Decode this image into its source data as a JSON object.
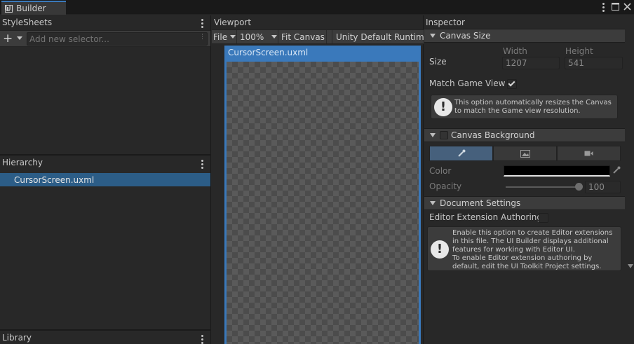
{
  "window": {
    "tab_title": "UI Builder"
  },
  "stylesheets": {
    "title": "StyleSheets",
    "add_symbol": "+",
    "selector_placeholder": "Add new selector...",
    "input_dots": "⋮"
  },
  "hierarchy": {
    "title": "Hierarchy",
    "items": [
      {
        "label": "CursorScreen.uxml",
        "selected": true
      }
    ]
  },
  "library": {
    "title": "Library"
  },
  "viewport": {
    "title": "Viewport",
    "toolbar": {
      "file": "File",
      "zoom": "100%",
      "fit_canvas": "Fit Canvas",
      "theme": "Unity Default Runtime"
    },
    "canvas_title": "CursorScreen.uxml"
  },
  "inspector": {
    "title": "Inspector",
    "canvas_size": {
      "header": "Canvas Size",
      "size_label": "Size",
      "width_label": "Width",
      "height_label": "Height",
      "width_value": "1207",
      "height_value": "541",
      "match_game_view_label": "Match Game View",
      "match_game_view_checked": true,
      "help_text": "This option automatically resizes the Canvas to match the Game view resolution."
    },
    "canvas_background": {
      "header": "Canvas Background",
      "enabled": false,
      "color_label": "Color",
      "color_value": "#000000",
      "opacity_label": "Opacity",
      "opacity_value": "100",
      "opacity_level": 1.0
    },
    "document_settings": {
      "header": "Document Settings",
      "editor_extension_label": "Editor Extension Authoring",
      "editor_extension_checked": false,
      "help_text_1": "Enable this option to create Editor extensions in this file. The UI Builder displays additional features for working with Editor UI.",
      "help_text_2": "To enable Editor extension authoring by default, edit the UI Toolkit Project settings."
    },
    "warning_symbol": "!"
  },
  "colors": {
    "accent": "#3a79bb",
    "selection": "#2c5d87",
    "panel_bg": "#282828",
    "toolbar_bg": "#3c3c3c"
  }
}
